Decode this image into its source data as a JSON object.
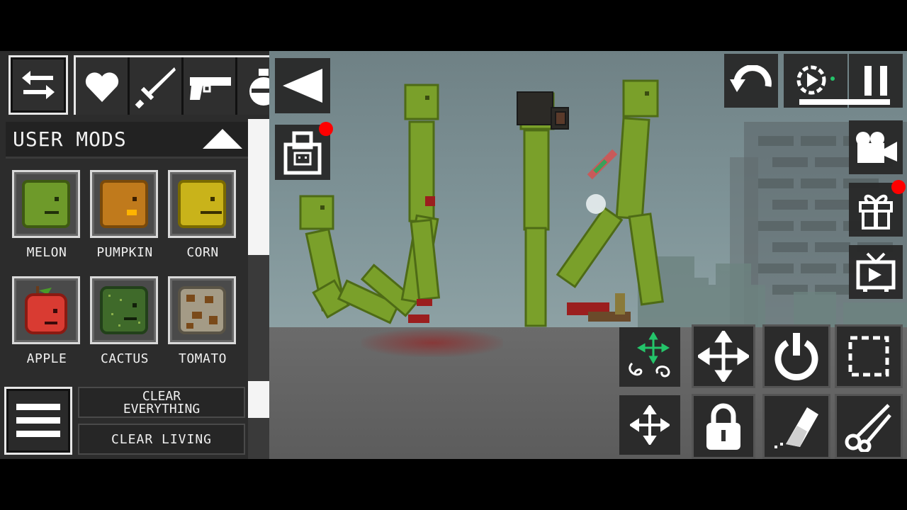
{
  "left_panel": {
    "user_mods_title": "USER  MODS",
    "items": [
      {
        "label": "MELON",
        "color": "#6e9a2a"
      },
      {
        "label": "PUMPKIN",
        "color": "#c07a1c"
      },
      {
        "label": "CORN",
        "color": "#c9b31a"
      },
      {
        "label": "APPLE",
        "color": "#d93b32"
      },
      {
        "label": "CACTUS",
        "color": "#3f6a2a"
      },
      {
        "label": "TOMATO",
        "color": "#a49b86"
      }
    ],
    "clear_everything_line1": "CLEAR",
    "clear_everything_line2": "EVERYTHING",
    "clear_living": "CLEAR LIVING",
    "category_icons": [
      "heart-icon",
      "sword-icon",
      "pistol-icon",
      "grenade-icon"
    ]
  },
  "scene": {
    "sky_color": "#7f9498",
    "ground_color": "#646464",
    "melon_color": "#7aa02a",
    "blood_color": "#9b1e1e"
  },
  "toolbar_icons": {
    "top_left": [
      "back-triangle-icon",
      "shop-bag-icon"
    ],
    "top_right": [
      "undo-icon",
      "slow-motion-icon",
      "pause-icon"
    ],
    "right_column": [
      "camera-icon",
      "gift-icon",
      "tv-icon"
    ],
    "tools": [
      "drag-mode-icon",
      "move-icon",
      "power-icon",
      "select-icon",
      "pan-icon",
      "lock-icon",
      "eraser-icon",
      "cut-icon"
    ]
  },
  "accent": {
    "notification_dot": "#ff0000",
    "drag_arrow_green": "#24c46a"
  }
}
